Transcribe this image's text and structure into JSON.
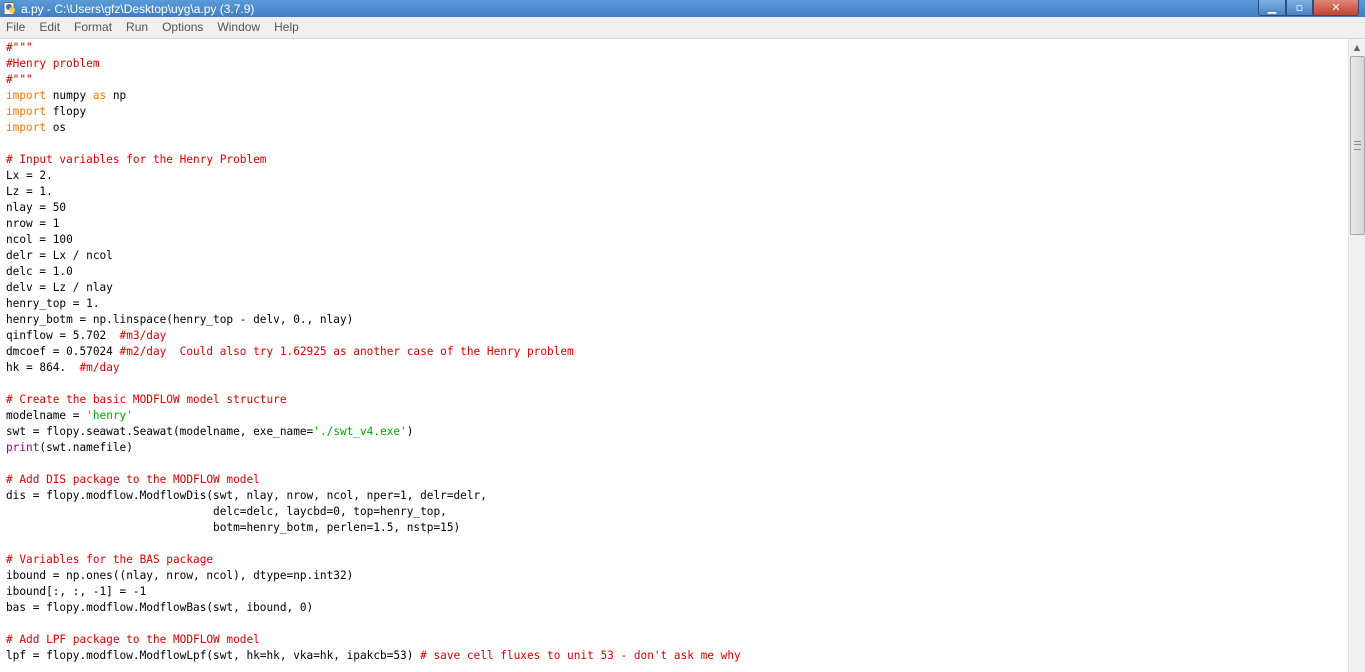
{
  "window": {
    "title": "a.py - C:\\Users\\gfz\\Desktop\\uyg\\a.py (3.7.9)",
    "controls": {
      "minimize": "▁",
      "maximize": "▫",
      "close": "✕"
    }
  },
  "menu": {
    "items": [
      "File",
      "Edit",
      "Format",
      "Run",
      "Options",
      "Window",
      "Help"
    ]
  },
  "colors": {
    "comment": "#dd0000",
    "keyword": "#ff7700",
    "string": "#00aa00",
    "builtin": "#900090",
    "titlebar": "#4a88cc"
  },
  "editor": {
    "lines": [
      [
        [
          "comment",
          "#\"\"\""
        ]
      ],
      [
        [
          "comment",
          "#Henry problem"
        ]
      ],
      [
        [
          "comment",
          "#\"\"\""
        ]
      ],
      [
        [
          "keyword",
          "import"
        ],
        [
          "plain",
          " numpy "
        ],
        [
          "keyword",
          "as"
        ],
        [
          "plain",
          " np"
        ]
      ],
      [
        [
          "keyword",
          "import"
        ],
        [
          "plain",
          " flopy"
        ]
      ],
      [
        [
          "keyword",
          "import"
        ],
        [
          "plain",
          " os"
        ]
      ],
      [],
      [
        [
          "comment",
          "# Input variables for the Henry Problem"
        ]
      ],
      [
        [
          "plain",
          "Lx = 2."
        ]
      ],
      [
        [
          "plain",
          "Lz = 1."
        ]
      ],
      [
        [
          "plain",
          "nlay = 50"
        ]
      ],
      [
        [
          "plain",
          "nrow = 1"
        ]
      ],
      [
        [
          "plain",
          "ncol = 100"
        ]
      ],
      [
        [
          "plain",
          "delr = Lx / ncol"
        ]
      ],
      [
        [
          "plain",
          "delc = 1.0"
        ]
      ],
      [
        [
          "plain",
          "delv = Lz / nlay"
        ]
      ],
      [
        [
          "plain",
          "henry_top = 1."
        ]
      ],
      [
        [
          "plain",
          "henry_botm = np.linspace(henry_top - delv, 0., nlay)"
        ]
      ],
      [
        [
          "plain",
          "qinflow = 5.702  "
        ],
        [
          "comment",
          "#m3/day"
        ]
      ],
      [
        [
          "plain",
          "dmcoef = 0.57024 "
        ],
        [
          "comment",
          "#m2/day  Could also try 1.62925 as another case of the Henry problem"
        ]
      ],
      [
        [
          "plain",
          "hk = 864.  "
        ],
        [
          "comment",
          "#m/day"
        ]
      ],
      [],
      [
        [
          "comment",
          "# Create the basic MODFLOW model structure"
        ]
      ],
      [
        [
          "plain",
          "modelname = "
        ],
        [
          "string",
          "'henry'"
        ]
      ],
      [
        [
          "plain",
          "swt = flopy.seawat.Seawat(modelname, exe_name="
        ],
        [
          "string",
          "'./swt_v4.exe'"
        ],
        [
          "plain",
          ")"
        ]
      ],
      [
        [
          "builtin",
          "print"
        ],
        [
          "plain",
          "(swt.namefile)"
        ]
      ],
      [],
      [
        [
          "comment",
          "# Add DIS package to the MODFLOW model"
        ]
      ],
      [
        [
          "plain",
          "dis = flopy.modflow.ModflowDis(swt, nlay, nrow, ncol, nper=1, delr=delr,"
        ]
      ],
      [
        [
          "plain",
          "                               delc=delc, laycbd=0, top=henry_top,"
        ]
      ],
      [
        [
          "plain",
          "                               botm=henry_botm, perlen=1.5, nstp=15)"
        ]
      ],
      [],
      [
        [
          "comment",
          "# Variables for the BAS package"
        ]
      ],
      [
        [
          "plain",
          "ibound = np.ones((nlay, nrow, ncol), dtype=np.int32)"
        ]
      ],
      [
        [
          "plain",
          "ibound[:, :, -1] = -1"
        ]
      ],
      [
        [
          "plain",
          "bas = flopy.modflow.ModflowBas(swt, ibound, 0)"
        ]
      ],
      [],
      [
        [
          "comment",
          "# Add LPF package to the MODFLOW model"
        ]
      ],
      [
        [
          "plain",
          "lpf = flopy.modflow.ModflowLpf(swt, hk=hk, vka=hk, ipakcb=53) "
        ],
        [
          "comment",
          "# save cell fluxes to unit 53 - don't ask me why"
        ]
      ]
    ]
  }
}
